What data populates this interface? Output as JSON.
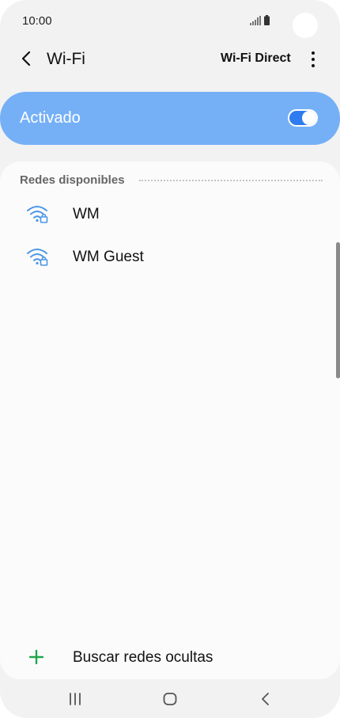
{
  "status_bar": {
    "time": "10:00",
    "icons": [
      "signal-icon",
      "battery-icon"
    ]
  },
  "app_bar": {
    "back_icon": "back-arrow-icon",
    "title": "Wi-Fi",
    "wifi_direct": "Wi-Fi Direct",
    "more_icon": "more-vert-icon"
  },
  "master_switch": {
    "label": "Activado",
    "on": true,
    "color": "#75b0f7",
    "toggle_color": "#2f7cf0"
  },
  "networks": {
    "header": "Redes disponibles",
    "items": [
      {
        "name": "WM",
        "icon": "wifi-secure-icon"
      },
      {
        "name": "WM Guest",
        "icon": "wifi-secure-icon"
      }
    ],
    "add_hidden": {
      "label": "Buscar redes ocultas",
      "icon": "plus-icon",
      "icon_color": "#1fa64a"
    }
  },
  "nav_bar": {
    "icons": [
      "recents-icon",
      "home-icon",
      "back-icon"
    ]
  }
}
